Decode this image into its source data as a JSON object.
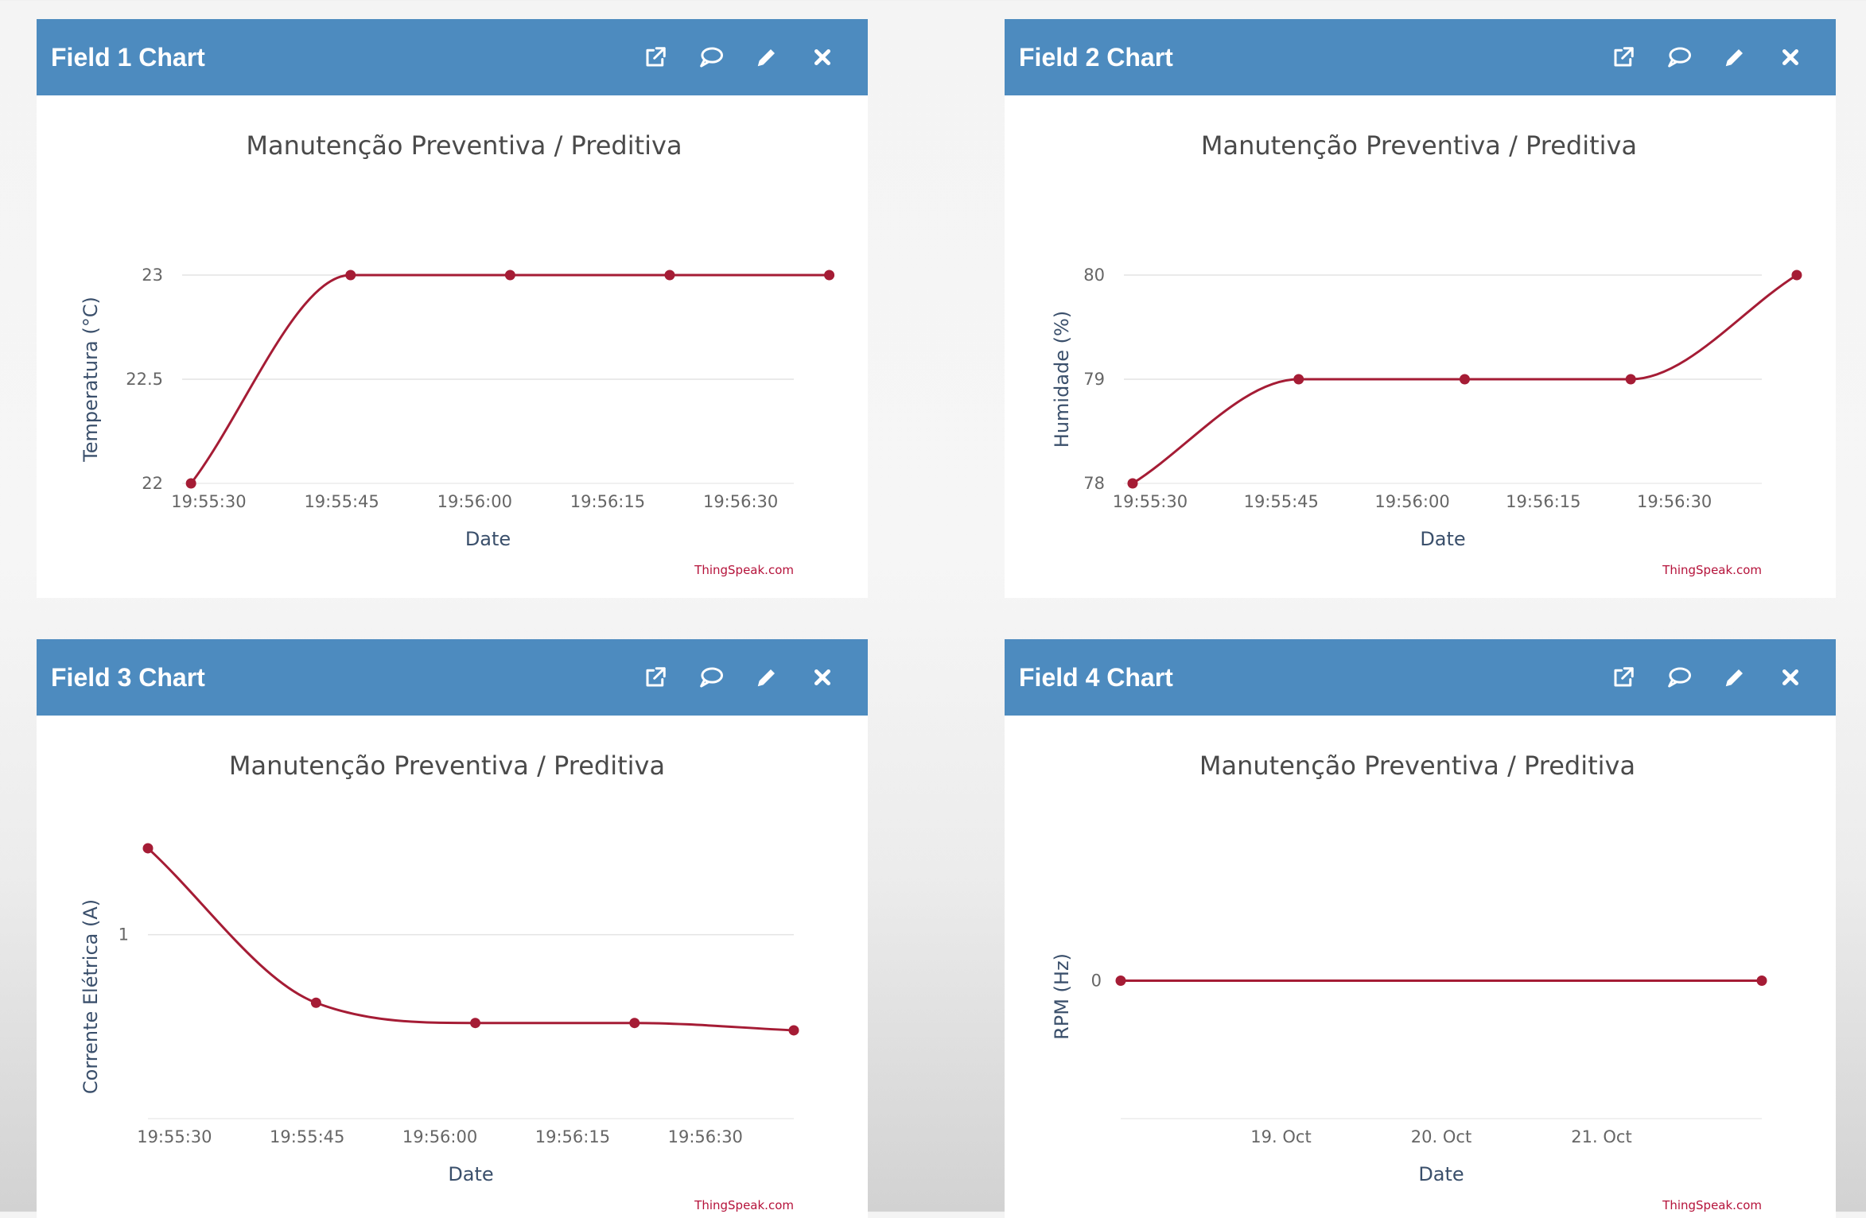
{
  "colors": {
    "header": "#4d8bbf",
    "series": "#a51c35",
    "grid": "#e4e4e4"
  },
  "panel_actions": [
    {
      "icon": "external-window-icon"
    },
    {
      "icon": "comment-icon"
    },
    {
      "icon": "pencil-icon"
    },
    {
      "icon": "close-icon"
    }
  ],
  "panels": [
    {
      "title": "Field 1 Chart"
    },
    {
      "title": "Field 2 Chart"
    },
    {
      "title": "Field 3 Chart"
    },
    {
      "title": "Field 4 Chart"
    }
  ],
  "chart_data": [
    {
      "type": "line",
      "title": "Manutenção Preventiva / Preditiva",
      "xlabel": "Date",
      "ylabel": "Temperatura (°C)",
      "credit": "ThingSpeak.com",
      "x_ticks": [
        "19:55:30",
        "19:55:45",
        "19:56:00",
        "19:56:15",
        "19:56:30"
      ],
      "y_ticks": [
        "22",
        "22.5",
        "23"
      ],
      "x_range": [
        "19:55:27",
        "19:56:36"
      ],
      "ylim": [
        22,
        23
      ],
      "series": [
        {
          "x": [
            "19:55:28",
            "19:55:46",
            "19:56:04",
            "19:56:22",
            "19:56:40"
          ],
          "y": [
            22,
            23,
            23,
            23,
            23
          ]
        }
      ]
    },
    {
      "type": "line",
      "title": "Manutenção Preventiva / Preditiva",
      "xlabel": "Date",
      "ylabel": "Humidade (%)",
      "credit": "ThingSpeak.com",
      "x_ticks": [
        "19:55:30",
        "19:55:45",
        "19:56:00",
        "19:56:15",
        "19:56:30"
      ],
      "y_ticks": [
        "78",
        "79",
        "80"
      ],
      "x_range": [
        "19:55:27",
        "19:56:40"
      ],
      "ylim": [
        78,
        80
      ],
      "series": [
        {
          "x": [
            "19:55:28",
            "19:55:47",
            "19:56:06",
            "19:56:25",
            "19:56:44"
          ],
          "y": [
            78,
            79,
            79,
            79,
            80
          ]
        }
      ]
    },
    {
      "type": "line",
      "title": "Manutenção Preventiva / Preditiva",
      "xlabel": "Date",
      "ylabel": "Corrente Elétrica (A)",
      "credit": "ThingSpeak.com",
      "x_ticks": [
        "19:55:30",
        "19:55:45",
        "19:56:00",
        "19:56:15",
        "19:56:30"
      ],
      "y_ticks": [
        "1"
      ],
      "x_range": [
        "19:55:27",
        "19:56:40"
      ],
      "ylim": [
        0,
        1.5
      ],
      "series": [
        {
          "x": [
            "19:55:27",
            "19:55:46",
            "19:56:04",
            "19:56:22",
            "19:56:40"
          ],
          "y": [
            1.47,
            0.63,
            0.52,
            0.52,
            0.48
          ]
        }
      ]
    },
    {
      "type": "line",
      "title": "Manutenção Preventiva / Preditiva",
      "xlabel": "Date",
      "ylabel": "RPM (Hz)",
      "credit": "ThingSpeak.com",
      "x_ticks": [
        "19. Oct",
        "20. Oct",
        "21. Oct"
      ],
      "y_ticks": [
        "0"
      ],
      "x_range": [
        "18. Oct",
        "22. Oct"
      ],
      "ylim": [
        -1,
        1
      ],
      "series": [
        {
          "x": [
            "18. Oct",
            "22. Oct"
          ],
          "y": [
            0,
            0
          ]
        }
      ]
    }
  ]
}
